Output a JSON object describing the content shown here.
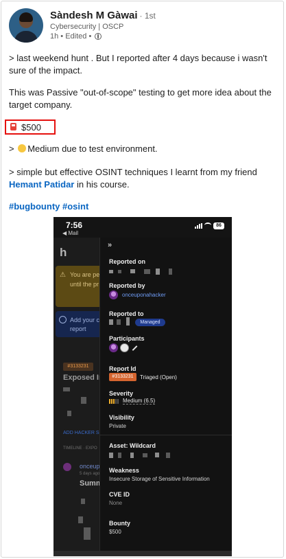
{
  "post": {
    "author_name": "Sàndesh M Gàwai",
    "degree": "· 1st",
    "headline": "Cybersecurity | OSCP",
    "meta": "1h • Edited •",
    "para1": "> last weekend hunt . But I reported after 4 days because i wasn't sure of the impact.",
    "para2": "This was Passive \"out-of-scope\" testing to get more idea about the target company.",
    "bounty": "$500",
    "para3": "Medium due to test environment.",
    "para3_prefix": "> ",
    "para4_prefix": "> simple but effective OSINT techniques I learnt from my friend ",
    "mention": "Hemant Patidar",
    "para4_suffix": " in his course.",
    "hashtags": "#bugbounty #osint"
  },
  "phone": {
    "time": "7:56",
    "back_label": "◀ Mail",
    "battery": "86",
    "background": {
      "logo": "h",
      "warn_text_1": "You are pe",
      "warn_text_2": "until the pr",
      "info_text_1": "Add your c",
      "info_text_2": "report",
      "tag": "#3133231",
      "title": "Exposed Int",
      "add_hacker": "ADD HACKER SU",
      "timeline": "TIMELINE · EXPO",
      "user": "onceupo",
      "ago": "5 days ago",
      "summary": "Summa"
    },
    "panel": {
      "collapse": "»",
      "reported_on_label": "Reported on",
      "reported_by_label": "Reported by",
      "reported_by_user": "onceuponahacker",
      "reported_to_label": "Reported to",
      "managed": "Managed",
      "participants_label": "Participants",
      "report_id_label": "Report Id",
      "report_id": "#3133231",
      "report_status": "Triaged (Open)",
      "severity_label": "Severity",
      "severity": "Medium (6.5)",
      "visibility_label": "Visibility",
      "visibility": "Private",
      "asset_label": "Asset: Wildcard",
      "weakness_label": "Weakness",
      "weakness": "Insecure Storage of Sensitive Information",
      "cve_label": "CVE ID",
      "cve": "None",
      "bounty_label": "Bounty",
      "bounty": "$500"
    }
  },
  "colors": {
    "link": "#0a66c2",
    "highlight_border": "#e5100e",
    "report_id_badge": "#d5652f",
    "managed_badge": "#1f3b8e",
    "severity": "#f2b12d"
  },
  "icons": [
    "globe-icon",
    "fuel-pump-icon",
    "grinning-emoji-icon",
    "signal-icon",
    "wifi-icon",
    "battery-icon",
    "collapse-chevrons-icon",
    "pencil-icon",
    "warning-icon",
    "info-icon"
  ]
}
